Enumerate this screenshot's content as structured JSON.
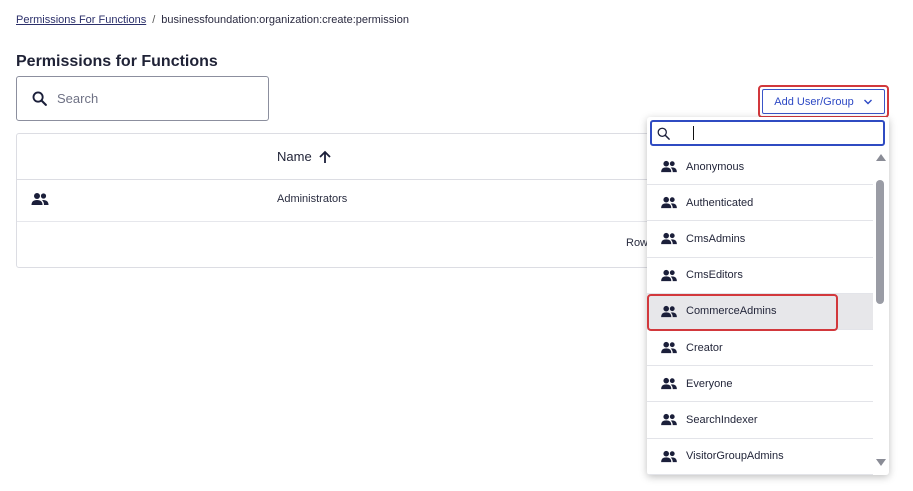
{
  "breadcrumb": {
    "link": "Permissions For Functions",
    "separator": "/",
    "current": "businessfoundation:organization:create:permission"
  },
  "page": {
    "title": "Permissions for Functions"
  },
  "search": {
    "placeholder": "Search",
    "icon": "search-icon"
  },
  "grid": {
    "columns": [
      {
        "label": "Name",
        "sort": "ascending"
      }
    ],
    "rows": [
      {
        "name": "Administrators",
        "icon": "group-icon"
      }
    ],
    "footer_partial": "Row"
  },
  "toolbar": {
    "add_label": "Add User/Group",
    "accent": "#2c48c4",
    "highlight": "#d2383c"
  },
  "dropdown": {
    "search_value": "",
    "items": [
      {
        "label": "Anonymous"
      },
      {
        "label": "Authenticated"
      },
      {
        "label": "CmsAdmins"
      },
      {
        "label": "CmsEditors"
      },
      {
        "label": "CommerceAdmins",
        "highlighted": true
      },
      {
        "label": "Creator"
      },
      {
        "label": "Everyone"
      },
      {
        "label": "SearchIndexer"
      },
      {
        "label": "VisitorGroupAdmins"
      }
    ]
  }
}
